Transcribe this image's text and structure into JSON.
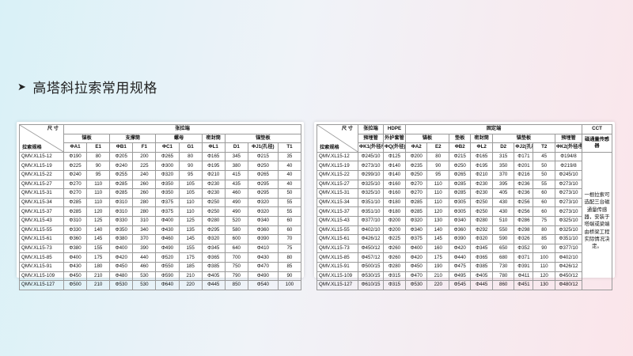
{
  "slide": {
    "title": "高塔斜拉索常用规格",
    "bullet_icon": "triangle-right-icon"
  },
  "left_table": {
    "header": {
      "size_label": "尺 寸",
      "model_label": "拉索规格",
      "group": "张拉端",
      "subgroups": [
        {
          "label": "锚板",
          "span": 2
        },
        {
          "label": "支撑筒",
          "span": 2
        },
        {
          "label": "螺母",
          "span": 2
        },
        {
          "label": "密封筒",
          "span": 1
        },
        {
          "label": "锚垫板",
          "span": 3
        }
      ],
      "columns": [
        "ΦA1",
        "E1",
        "ΦB1",
        "F1",
        "ΦC1",
        "G1",
        "ΦL1",
        "D1",
        "ΦJ1(孔径)",
        "T1"
      ]
    },
    "rows": [
      [
        "QMV.XL15-12",
        "Φ190",
        "80",
        "Φ205",
        "200",
        "Φ265",
        "80",
        "Φ165",
        "345",
        "Φ215",
        "35"
      ],
      [
        "QMV.XL15-19",
        "Φ225",
        "90",
        "Φ240",
        "225",
        "Φ300",
        "90",
        "Φ195",
        "380",
        "Φ250",
        "40"
      ],
      [
        "QMV.XL15-22",
        "Φ240",
        "95",
        "Φ255",
        "240",
        "Φ320",
        "95",
        "Φ210",
        "415",
        "Φ265",
        "40"
      ],
      [
        "QMV.XL15-27",
        "Φ270",
        "110",
        "Φ285",
        "260",
        "Φ350",
        "105",
        "Φ230",
        "435",
        "Φ295",
        "40"
      ],
      [
        "QMV.XL15-31",
        "Φ270",
        "110",
        "Φ285",
        "260",
        "Φ350",
        "105",
        "Φ230",
        "460",
        "Φ295",
        "50"
      ],
      [
        "QMV.XL15-34",
        "Φ285",
        "110",
        "Φ310",
        "280",
        "Φ375",
        "110",
        "Φ250",
        "490",
        "Φ320",
        "55"
      ],
      [
        "QMV.XL15-37",
        "Φ285",
        "120",
        "Φ310",
        "280",
        "Φ375",
        "110",
        "Φ250",
        "490",
        "Φ320",
        "55"
      ],
      [
        "QMV.XL15-43",
        "Φ310",
        "125",
        "Φ330",
        "310",
        "Φ400",
        "125",
        "Φ280",
        "520",
        "Φ340",
        "60"
      ],
      [
        "QMV.XL15-55",
        "Φ330",
        "140",
        "Φ350",
        "340",
        "Φ430",
        "135",
        "Φ295",
        "580",
        "Φ360",
        "60"
      ],
      [
        "QMV.XL15-61",
        "Φ360",
        "145",
        "Φ380",
        "370",
        "Φ460",
        "145",
        "Φ320",
        "600",
        "Φ390",
        "70"
      ],
      [
        "QMV.XL15-73",
        "Φ380",
        "155",
        "Φ400",
        "390",
        "Φ490",
        "155",
        "Φ345",
        "640",
        "Φ410",
        "75"
      ],
      [
        "QMV.XL15-85",
        "Φ400",
        "175",
        "Φ420",
        "440",
        "Φ520",
        "175",
        "Φ365",
        "700",
        "Φ430",
        "80"
      ],
      [
        "QMV.XL15-91",
        "Φ430",
        "180",
        "Φ450",
        "460",
        "Φ550",
        "185",
        "Φ385",
        "750",
        "Φ470",
        "85"
      ],
      [
        "QMV.XL15-109",
        "Φ450",
        "210",
        "Φ480",
        "530",
        "Φ590",
        "210",
        "Φ405",
        "790",
        "Φ490",
        "90"
      ],
      [
        "QMV.XL15-127",
        "Φ500",
        "210",
        "Φ530",
        "530",
        "Φ640",
        "220",
        "Φ445",
        "850",
        "Φ540",
        "100"
      ]
    ]
  },
  "right_table": {
    "header": {
      "size_label": "尺 寸",
      "model_label": "拉索规格",
      "g_tension": "张拉端",
      "g_hdpe": "HDPE",
      "g_fixed": "固定端",
      "g_cct": "CCT",
      "sub_embed1": "预埋管",
      "sub_outer": "外护套管",
      "sub_anchor_plate": "锚板",
      "sub_pad": "垫板",
      "sub_seal": "密封筒",
      "sub_anchor_pad": "锚垫板",
      "sub_embed2": "预埋管",
      "sub_sensor": "磁通量传感器",
      "columns": [
        "ΦK1(外径/壁厚)",
        "ΦQ(外径)",
        "ΦA2",
        "E2",
        "ΦB2",
        "ΦL2",
        "D2",
        "ΦJ2(孔径)",
        "T2",
        "ΦK2(外径/壁厚)"
      ]
    },
    "rows": [
      [
        "QMV.XL15-12",
        "Φ245/10",
        "Φ125",
        "Φ200",
        "80",
        "Φ215",
        "Φ165",
        "315",
        "Φ171",
        "45",
        "Φ194/8"
      ],
      [
        "QMV.XL15-19",
        "Φ273/10",
        "Φ140",
        "Φ235",
        "90",
        "Φ250",
        "Φ195",
        "350",
        "Φ201",
        "50",
        "Φ219/8"
      ],
      [
        "QMV.XL15-22",
        "Φ299/10",
        "Φ140",
        "Φ250",
        "95",
        "Φ265",
        "Φ210",
        "370",
        "Φ216",
        "50",
        "Φ245/10"
      ],
      [
        "QMV.XL15-27",
        "Φ325/10",
        "Φ160",
        "Φ270",
        "110",
        "Φ285",
        "Φ230",
        "395",
        "Φ236",
        "55",
        "Φ273/10"
      ],
      [
        "QMV.XL15-31",
        "Φ325/10",
        "Φ160",
        "Φ270",
        "110",
        "Φ285",
        "Φ230",
        "405",
        "Φ236",
        "60",
        "Φ273/10"
      ],
      [
        "QMV.XL15-34",
        "Φ351/10",
        "Φ180",
        "Φ285",
        "110",
        "Φ305",
        "Φ250",
        "430",
        "Φ256",
        "60",
        "Φ273/10"
      ],
      [
        "QMV.XL15-37",
        "Φ351/10",
        "Φ180",
        "Φ285",
        "120",
        "Φ305",
        "Φ250",
        "430",
        "Φ256",
        "60",
        "Φ273/10"
      ],
      [
        "QMV.XL15-43",
        "Φ377/10",
        "Φ200",
        "Φ320",
        "130",
        "Φ340",
        "Φ280",
        "510",
        "Φ286",
        "75",
        "Φ325/10"
      ],
      [
        "QMV.XL15-55",
        "Φ402/10",
        "Φ200",
        "Φ340",
        "140",
        "Φ360",
        "Φ292",
        "550",
        "Φ298",
        "80",
        "Φ325/10"
      ],
      [
        "QMV.XL15-61",
        "Φ426/12",
        "Φ225",
        "Φ375",
        "145",
        "Φ390",
        "Φ320",
        "590",
        "Φ326",
        "85",
        "Φ351/10"
      ],
      [
        "QMV.XL15-73",
        "Φ450/12",
        "Φ260",
        "Φ400",
        "160",
        "Φ420",
        "Φ345",
        "650",
        "Φ352",
        "90",
        "Φ377/10"
      ],
      [
        "QMV.XL15-85",
        "Φ457/12",
        "Φ260",
        "Φ420",
        "175",
        "Φ440",
        "Φ365",
        "680",
        "Φ371",
        "100",
        "Φ402/10"
      ],
      [
        "QMV.XL15-91",
        "Φ500/15",
        "Φ280",
        "Φ450",
        "190",
        "Φ475",
        "Φ385",
        "730",
        "Φ391",
        "110",
        "Φ426/12"
      ],
      [
        "QMV.XL15-109",
        "Φ530/15",
        "Φ315",
        "Φ470",
        "210",
        "Φ495",
        "Φ405",
        "780",
        "Φ411",
        "120",
        "Φ450/12"
      ],
      [
        "QMV.XL15-127",
        "Φ610/15",
        "Φ315",
        "Φ530",
        "220",
        "Φ545",
        "Φ445",
        "860",
        "Φ451",
        "130",
        "Φ480/12"
      ]
    ],
    "remark": "一根拉索可选配三台磁通量传感器，安装于塔端或梁端由桥梁工程实际情况决定。"
  }
}
